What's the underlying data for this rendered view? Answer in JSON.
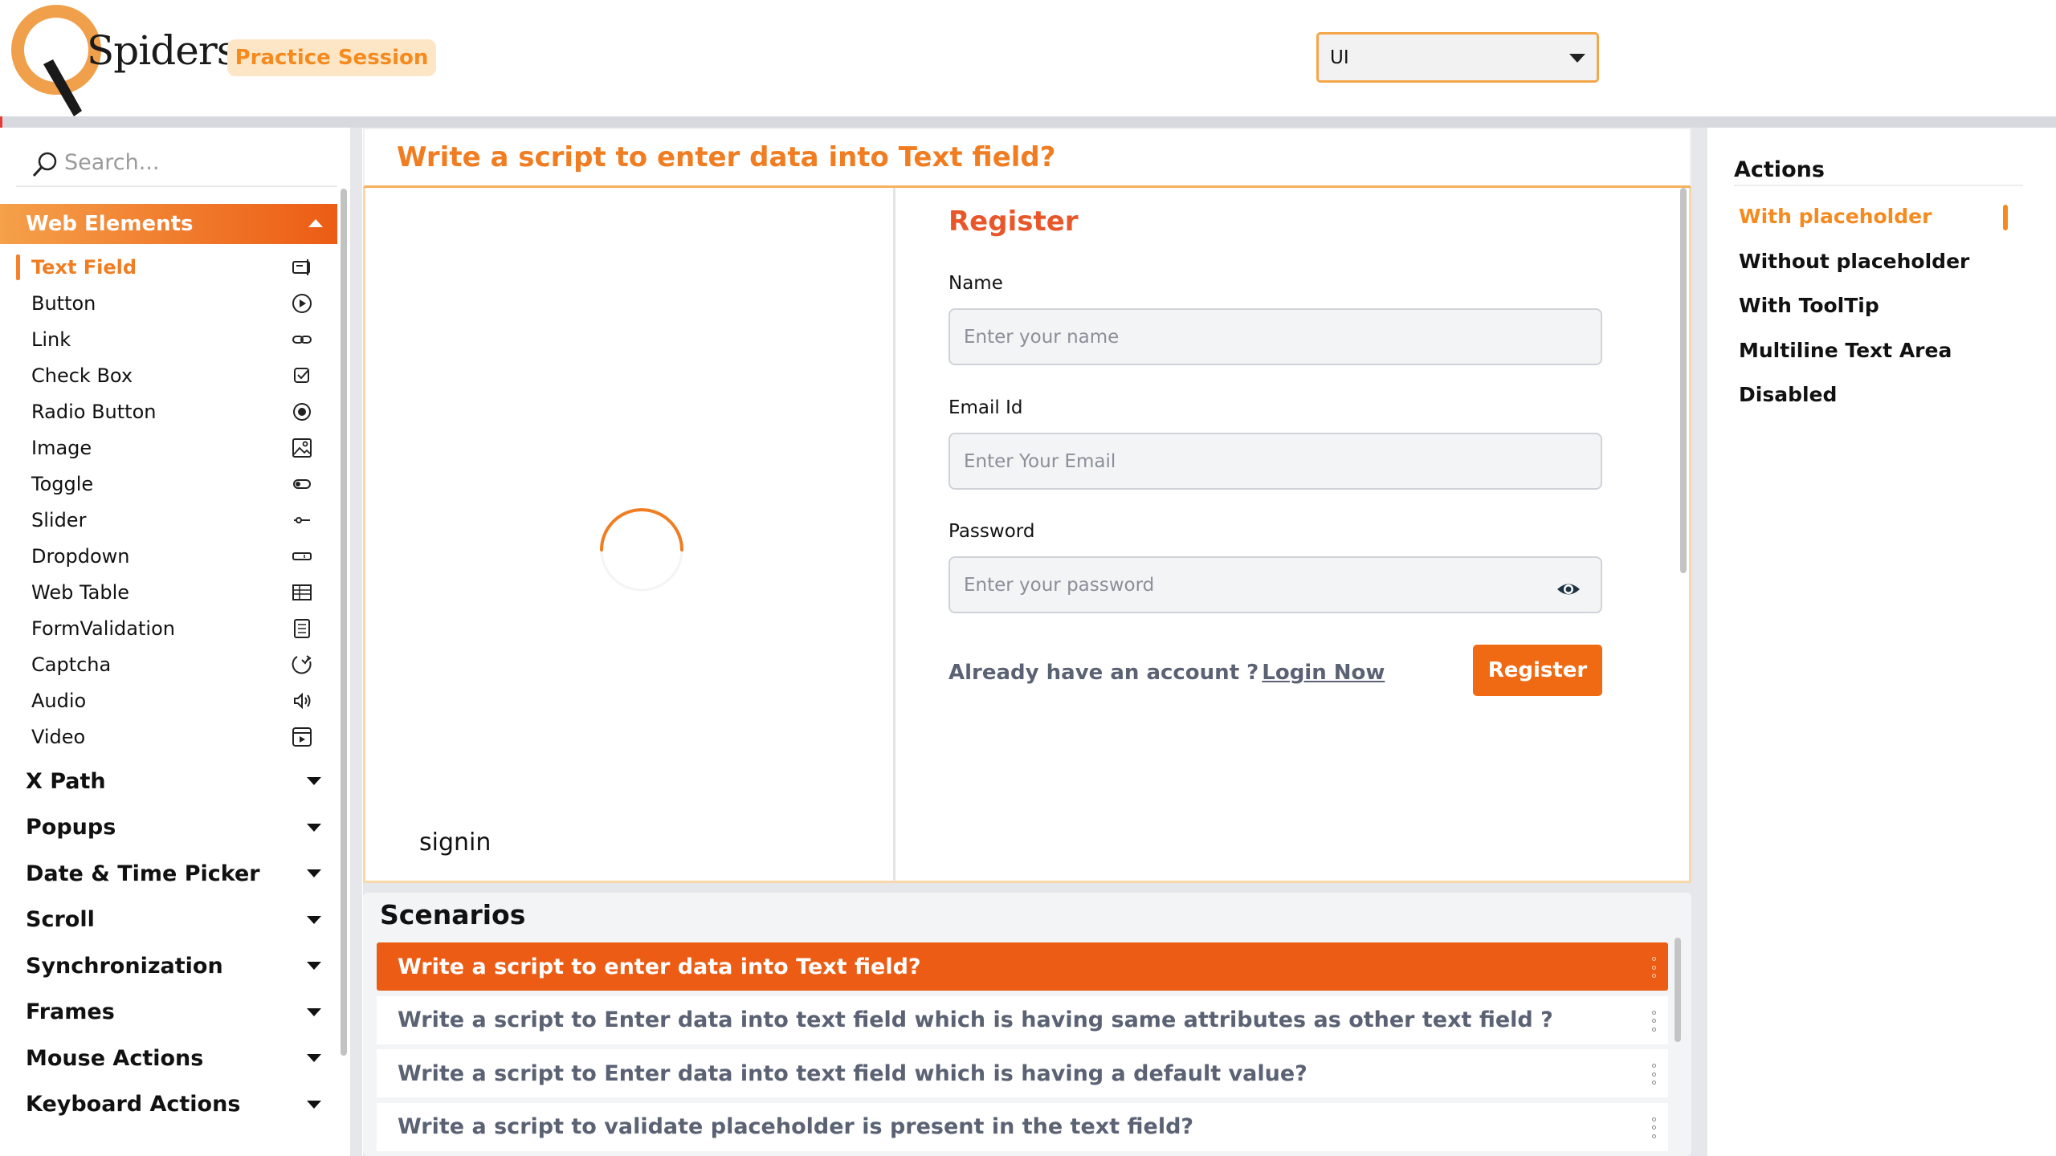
{
  "header": {
    "logo_text": "Spiders",
    "badge": "Practice Session",
    "select_value": "UI"
  },
  "sidebar": {
    "search_placeholder": "Search...",
    "active_category": "Web Elements",
    "sub_items": [
      {
        "label": "Text Field",
        "icon": "text-field-icon",
        "active": true
      },
      {
        "label": "Button",
        "icon": "play-circle-icon"
      },
      {
        "label": "Link",
        "icon": "link-icon"
      },
      {
        "label": "Check Box",
        "icon": "checkbox-icon"
      },
      {
        "label": "Radio Button",
        "icon": "radio-icon"
      },
      {
        "label": "Image",
        "icon": "image-icon"
      },
      {
        "label": "Toggle",
        "icon": "toggle-icon"
      },
      {
        "label": "Slider",
        "icon": "slider-icon"
      },
      {
        "label": "Dropdown",
        "icon": "dropdown-icon"
      },
      {
        "label": "Web Table",
        "icon": "table-icon"
      },
      {
        "label": "FormValidation",
        "icon": "form-icon"
      },
      {
        "label": "Captcha",
        "icon": "captcha-icon"
      },
      {
        "label": "Audio",
        "icon": "audio-icon"
      },
      {
        "label": "Video",
        "icon": "video-icon"
      }
    ],
    "categories": [
      "X Path",
      "Popups",
      "Date & Time Picker",
      "Scroll",
      "Synchronization",
      "Frames",
      "Mouse Actions",
      "Keyboard Actions"
    ]
  },
  "main": {
    "title": "Write a script to enter data into Text field?",
    "signin_label": "signin",
    "form": {
      "title": "Register",
      "name_label": "Name",
      "name_placeholder": "Enter your name",
      "email_label": "Email Id",
      "email_placeholder": "Enter Your Email",
      "password_label": "Password",
      "password_placeholder": "Enter your password",
      "account_text": "Already have an account ?",
      "login_link": "Login Now",
      "register_button": "Register"
    }
  },
  "scenarios": {
    "title": "Scenarios",
    "items": [
      {
        "label": "Write a script to enter data into Text field?",
        "active": true
      },
      {
        "label": "Write a script to Enter data into text field which is having same attributes as other text field ?"
      },
      {
        "label": "Write a script to Enter data into text field which is having a default value?"
      },
      {
        "label": "Write a script to validate placeholder is present in the text field?"
      }
    ]
  },
  "actions": {
    "title": "Actions",
    "items": [
      "With placeholder",
      "Without placeholder",
      "With ToolTip",
      "Multiline Text Area",
      "Disabled"
    ],
    "active_index": 0
  },
  "colors": {
    "accent": "#f07d22",
    "accent_dark": "#ec5c14",
    "badge_bg": "#fde6c6"
  }
}
